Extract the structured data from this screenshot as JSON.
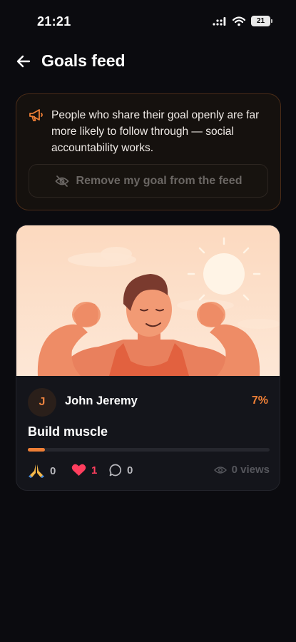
{
  "status_bar": {
    "time": "21:21",
    "battery": "21"
  },
  "header": {
    "title": "Goals feed"
  },
  "notice": {
    "text": "People who share their goal openly are far more likely to follow through — social accountability works.",
    "remove_button_label": "Remove my goal from the feed"
  },
  "goal_card": {
    "avatar_initial": "J",
    "user_name": "John Jeremy",
    "progress_label": "7%",
    "progress_fraction": 0.07,
    "title": "Build muscle",
    "reactions": {
      "pray_count": "0",
      "like_count": "1",
      "comment_count": "0"
    },
    "views_label": "0 views"
  },
  "colors": {
    "accent": "#ee7f36",
    "like": "#ff3e5e",
    "background": "#0b0b0f",
    "card": "#14151b"
  },
  "icons": [
    "back-arrow-icon",
    "megaphone-icon",
    "eye-off-icon",
    "pray-icon",
    "heart-icon",
    "comment-icon",
    "eye-icon",
    "signal-icon",
    "wifi-icon",
    "battery-icon"
  ]
}
